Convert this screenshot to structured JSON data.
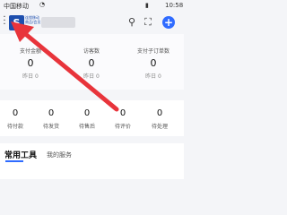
{
  "status_bar": {
    "carrier": "中国移动",
    "battery": "▮",
    "time": "10:58"
  },
  "header": {
    "logo_glyph": "S",
    "logo_text": "连锁移动\n商品/会员",
    "icons": [
      "more-vertical-icon",
      "search-icon",
      "scan-icon",
      "plus-icon"
    ]
  },
  "stats": [
    {
      "label": "支付金额",
      "value": "0",
      "sub": "昨日 0"
    },
    {
      "label": "访客数",
      "value": "0",
      "sub": "昨日 0"
    },
    {
      "label": "支付子订单数",
      "value": "0",
      "sub": "昨日 0"
    }
  ],
  "orders": [
    {
      "value": "0",
      "label": "待付款"
    },
    {
      "value": "0",
      "label": "待发货"
    },
    {
      "value": "0",
      "label": "待售后"
    },
    {
      "value": "0",
      "label": "待评价"
    },
    {
      "value": "0",
      "label": "待处理"
    }
  ],
  "tabs": {
    "common_tools": "常用工具",
    "my_services": "我的服务"
  },
  "colors": {
    "accent": "#2f6bff",
    "arrow": "#e8343b",
    "logo_bg": "#1e4fae"
  }
}
